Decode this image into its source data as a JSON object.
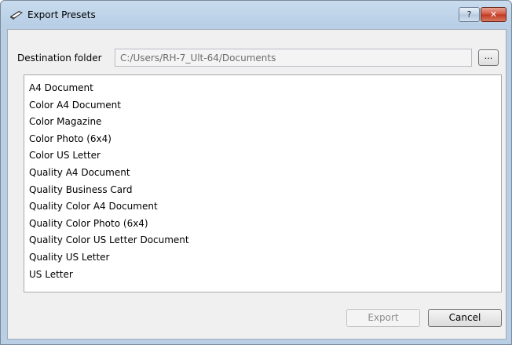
{
  "window": {
    "title": "Export Presets",
    "help_label": "?",
    "close_label": "✕"
  },
  "destination": {
    "label": "Destination folder",
    "value": "C:/Users/RH-7_Ult-64/Documents",
    "browse_label": "..."
  },
  "presets": [
    "A4 Document",
    "Color A4 Document",
    "Color Magazine",
    "Color Photo (6x4)",
    "Color US Letter",
    "Quality A4 Document",
    "Quality Business Card",
    "Quality Color A4 Document",
    "Quality Color Photo (6x4)",
    "Quality Color US Letter Document",
    "Quality US Letter",
    "US Letter"
  ],
  "buttons": {
    "export_label": "Export",
    "export_enabled": false,
    "cancel_label": "Cancel"
  },
  "colors": {
    "title_bar": "#b9cfe6",
    "close_button": "#c9452d",
    "dialog_background": "#f0f0f0"
  }
}
